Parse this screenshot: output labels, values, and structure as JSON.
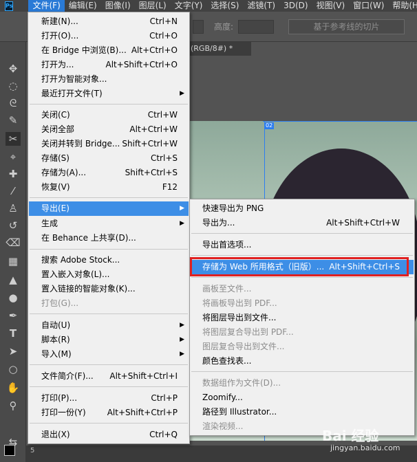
{
  "app": {
    "logo": "Ps"
  },
  "menubar": [
    {
      "label": "文件(F)",
      "active": true
    },
    {
      "label": "编辑(E)"
    },
    {
      "label": "图像(I)"
    },
    {
      "label": "图层(L)"
    },
    {
      "label": "文字(Y)"
    },
    {
      "label": "选择(S)"
    },
    {
      "label": "滤镜(T)"
    },
    {
      "label": "3D(D)"
    },
    {
      "label": "视图(V)"
    },
    {
      "label": "窗口(W)"
    },
    {
      "label": "帮助(H)"
    }
  ],
  "options": {
    "height_label": "高度:",
    "slice_button": "基于参考线的切片"
  },
  "document": {
    "tab_title": "(RGB/8#) *",
    "slice_tag": "02",
    "status_number": "5"
  },
  "file_menu": {
    "items": [
      {
        "label": "新建(N)...",
        "shortcut": "Ctrl+N"
      },
      {
        "label": "打开(O)...",
        "shortcut": "Ctrl+O"
      },
      {
        "label": "在 Bridge 中浏览(B)...",
        "shortcut": "Alt+Ctrl+O"
      },
      {
        "label": "打开为...",
        "shortcut": "Alt+Shift+Ctrl+O"
      },
      {
        "label": "打开为智能对象...",
        "shortcut": ""
      },
      {
        "label": "最近打开文件(T)",
        "shortcut": ""
      },
      {
        "label": "关闭(C)",
        "shortcut": "Ctrl+W"
      },
      {
        "label": "关闭全部",
        "shortcut": "Alt+Ctrl+W"
      },
      {
        "label": "关闭并转到 Bridge...",
        "shortcut": "Shift+Ctrl+W"
      },
      {
        "label": "存储(S)",
        "shortcut": "Ctrl+S"
      },
      {
        "label": "存储为(A)...",
        "shortcut": "Shift+Ctrl+S"
      },
      {
        "label": "恢复(V)",
        "shortcut": "F12"
      },
      {
        "label": "导出(E)",
        "shortcut": ""
      },
      {
        "label": "生成",
        "shortcut": ""
      },
      {
        "label": "在 Behance 上共享(D)...",
        "shortcut": ""
      },
      {
        "label": "搜索 Adobe Stock...",
        "shortcut": ""
      },
      {
        "label": "置入嵌入对象(L)...",
        "shortcut": ""
      },
      {
        "label": "置入链接的智能对象(K)...",
        "shortcut": ""
      },
      {
        "label": "打包(G)...",
        "shortcut": ""
      },
      {
        "label": "自动(U)",
        "shortcut": ""
      },
      {
        "label": "脚本(R)",
        "shortcut": ""
      },
      {
        "label": "导入(M)",
        "shortcut": ""
      },
      {
        "label": "文件简介(F)...",
        "shortcut": "Alt+Shift+Ctrl+I"
      },
      {
        "label": "打印(P)...",
        "shortcut": "Ctrl+P"
      },
      {
        "label": "打印一份(Y)",
        "shortcut": "Alt+Shift+Ctrl+P"
      },
      {
        "label": "退出(X)",
        "shortcut": "Ctrl+Q"
      }
    ]
  },
  "export_menu": {
    "items": [
      {
        "label": "快速导出为 PNG",
        "shortcut": ""
      },
      {
        "label": "导出为...",
        "shortcut": "Alt+Shift+Ctrl+W"
      },
      {
        "label": "导出首选项...",
        "shortcut": ""
      },
      {
        "label": "存储为 Web 所用格式（旧版）...",
        "shortcut": "Alt+Shift+Ctrl+S"
      },
      {
        "label": "画板至文件...",
        "shortcut": ""
      },
      {
        "label": "将画板导出到 PDF...",
        "shortcut": ""
      },
      {
        "label": "将图层导出到文件...",
        "shortcut": ""
      },
      {
        "label": "将图层复合导出到 PDF...",
        "shortcut": ""
      },
      {
        "label": "图层复合导出到文件...",
        "shortcut": ""
      },
      {
        "label": "颜色查找表...",
        "shortcut": ""
      },
      {
        "label": "数据组作为文件(D)...",
        "shortcut": ""
      },
      {
        "label": "Zoomify...",
        "shortcut": ""
      },
      {
        "label": "路径到 Illustrator...",
        "shortcut": ""
      },
      {
        "label": "渲染视频...",
        "shortcut": ""
      }
    ]
  },
  "watermark": {
    "brand": "Bai 经验",
    "url": "jingyan.baidu.com"
  },
  "colors": {
    "highlight": "#3d8ee6",
    "callout_border": "#e02020",
    "slice_guide": "#2c7df0"
  }
}
